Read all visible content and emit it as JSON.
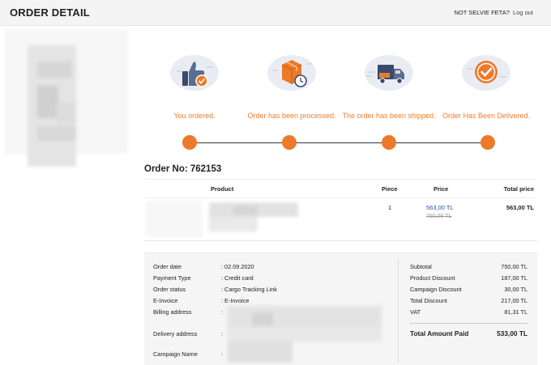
{
  "header": {
    "title": "ORDER DETAIL",
    "user_name": "NOT SELVIE FETA?",
    "logout_label": "Log out"
  },
  "steps": [
    {
      "label": "You ordered.",
      "icon": "thumbs-up-icon"
    },
    {
      "label": "Order has been processed.",
      "icon": "package-clock-icon"
    },
    {
      "label": "The order has been shipped.",
      "icon": "delivery-truck-icon"
    },
    {
      "label": "Order Has Been Delivered.",
      "icon": "check-circle-icon"
    }
  ],
  "order": {
    "number_label": "Order No: 762153"
  },
  "products_table": {
    "columns": [
      "Product",
      "Piece",
      "Price",
      "Total price"
    ],
    "rows": [
      {
        "product": "",
        "piece": "1",
        "price": "563,00 TL",
        "old_price": "750,00 TL",
        "total": "563,00 TL"
      }
    ]
  },
  "details": [
    {
      "key": "Order date",
      "value": ": 02.09.2020"
    },
    {
      "key": "Payment Type",
      "value": ": Credit card"
    },
    {
      "key": "Order status",
      "value": ": Cargo Tracking Link"
    },
    {
      "key": "E-Invoice",
      "value": ": E-Invoice"
    },
    {
      "key": "Billing address",
      "value": ":"
    },
    {
      "key": "Delivery address",
      "value": ":"
    },
    {
      "key": "Campaign Name",
      "value": ":"
    }
  ],
  "totals": [
    {
      "key": "Subtotal",
      "value": "750,00 TL"
    },
    {
      "key": "Product Discount",
      "value": "187,00 TL"
    },
    {
      "key": "Campaign Discount",
      "value": "30,00 TL"
    },
    {
      "key": "Total Discount",
      "value": "217,00 TL"
    },
    {
      "key": "VAT",
      "value": "81,31 TL"
    }
  ],
  "grand_total": {
    "key": "Total Amount Paid",
    "value": "533,00 TL"
  },
  "colors": {
    "accent": "#ec7a2a",
    "link_price": "#2b4fa8"
  }
}
